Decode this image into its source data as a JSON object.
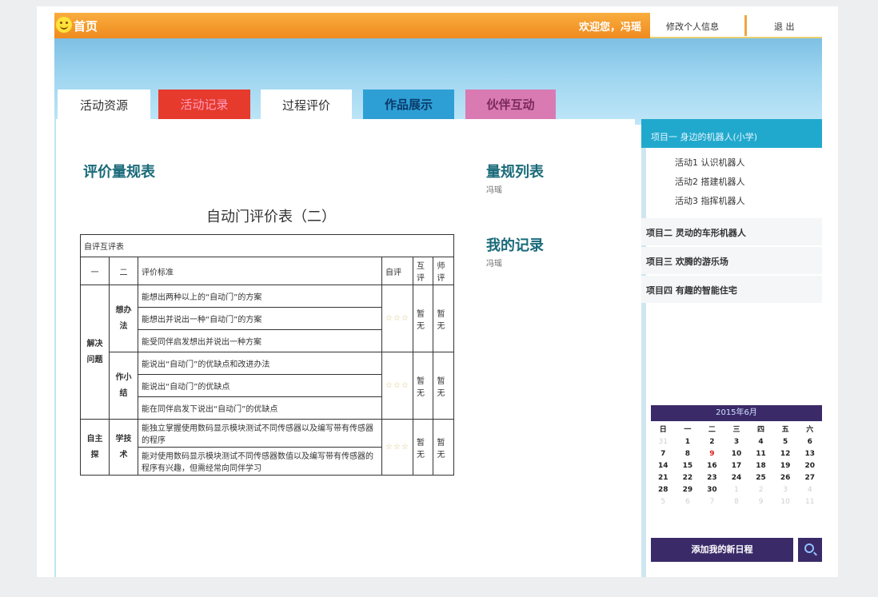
{
  "topbar": {
    "home": "首页",
    "welcome": "欢迎您，冯瑶",
    "profile": "修改个人信息",
    "logout": "退 出"
  },
  "tabs": [
    "活动资源",
    "活动记录",
    "过程评价",
    "作品展示",
    "伙伴互动"
  ],
  "main": {
    "heading": "评价量规表",
    "list_heading": "量规列表",
    "list_sub": "冯瑶",
    "records_heading": "我的记录",
    "records_sub": "冯瑶",
    "table_title": "自动门评价表（二）"
  },
  "table": {
    "caption": "自评互评表",
    "headers": [
      "一",
      "二",
      "评价标准",
      "自评",
      "互评",
      "师评"
    ],
    "group1": "解决问题",
    "sub1": "想办法",
    "sub1_rows": [
      "能想出两种以上的“自动门”的方案",
      "能想出并说出一种“自动门”的方案",
      "能受同伴启发想出并说出一种方案"
    ],
    "sub2": "作小结",
    "sub2_rows": [
      "能说出“自动门”的优缺点和改进办法",
      "能说出“自动门”的优缺点",
      "能在同伴启发下说出“自动门”的优缺点"
    ],
    "group2": "自主探",
    "sub3": "学技术",
    "sub3_rows": [
      "能独立掌握使用数码显示模块测试不同传感器以及编写带有传感器的程序",
      "能对使用数码显示模块测试不同传感器数值以及编写带有传感器的程序有兴趣，但需经常向同伴学习"
    ],
    "stars": "☆☆☆",
    "none": "暂无"
  },
  "sidebar": {
    "project1": "项目一 身边的机器人(小学)",
    "activities": [
      "活动1 认识机器人",
      "活动2 搭建机器人",
      "活动3 指挥机器人"
    ],
    "projects": [
      "项目二 灵动的车形机器人",
      "项目三 欢腾的游乐场",
      "项目四 有趣的智能住宅"
    ]
  },
  "calendar": {
    "title": "2015年6月",
    "weekdays": [
      "日",
      "一",
      "二",
      "三",
      "四",
      "五",
      "六"
    ],
    "prev_month_days": [
      "31"
    ],
    "days": [
      "1",
      "2",
      "3",
      "4",
      "5",
      "6",
      "7",
      "8",
      "9",
      "10",
      "11",
      "12",
      "13",
      "14",
      "15",
      "16",
      "17",
      "18",
      "19",
      "20",
      "21",
      "22",
      "23",
      "24",
      "25",
      "26",
      "27",
      "28",
      "29",
      "30"
    ],
    "next_month_days": [
      "1",
      "2",
      "3",
      "4",
      "5",
      "6",
      "7",
      "8",
      "9",
      "10",
      "11"
    ],
    "today": "9"
  },
  "add_schedule": "添加我的新日程",
  "icons": {
    "search": "search-icon",
    "logo": "smiley-icon"
  },
  "colors": {
    "topbar": "#ef8a1f",
    "tab_red": "#e63a2d",
    "tab_blue": "#2d9fd5",
    "tab_pink": "#d97ab3",
    "sidebar_band": "#21a9cd",
    "calendar": "#3a2a68"
  }
}
